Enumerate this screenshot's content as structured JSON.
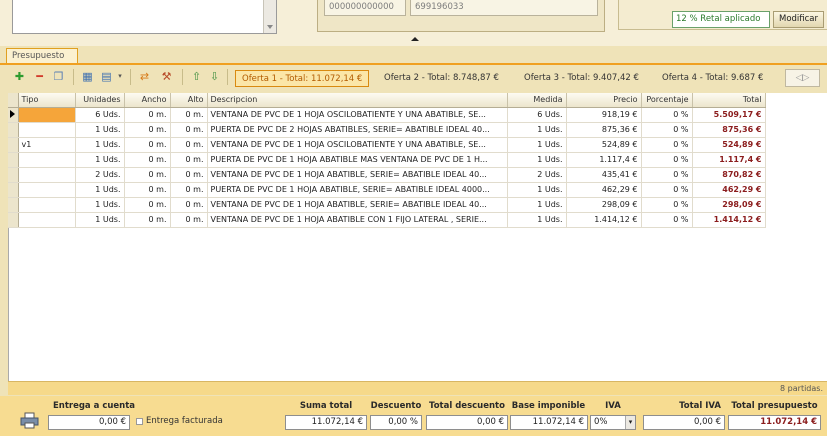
{
  "header": {
    "phone1": "000000000000",
    "phone2": "699196033",
    "retal_text": "12 % Retal aplicado",
    "modificar_label": "Modificar"
  },
  "tab": {
    "label": "Presupuesto"
  },
  "toolbar": {
    "icons": [
      "add-icon",
      "remove-icon",
      "copy-icon",
      "calculator-icon",
      "list-dropdown-icon",
      "transfer-icon",
      "tools-icon",
      "arrow-up-icon",
      "arrow-down-icon"
    ],
    "ofertas": [
      "Oferta 1 - Total: 11.072,14 €",
      "Oferta 2 - Total: 8.748,87 €",
      "Oferta 3 - Total: 9.407,42 €",
      "Oferta 4 - Total: 9.687 €"
    ],
    "active_oferta": 0
  },
  "table": {
    "headers": {
      "tipo": "Tipo",
      "unidades": "Unidades",
      "ancho": "Ancho",
      "alto": "Alto",
      "descripcion": "Descripcion",
      "medida": "Medida",
      "precio": "Precio",
      "porcentaje": "Porcentaje",
      "total": "Total"
    },
    "rows": [
      {
        "tipo": "",
        "unidades": "6 Uds.",
        "ancho": "0 m.",
        "alto": "0 m.",
        "descripcion": "VENTANA DE PVC DE 1 HOJA OSCILOBATIENTE Y UNA ABATIBLE, SE...",
        "medida": "6 Uds.",
        "precio": "918,19 €",
        "porcentaje": "0 %",
        "total": "5.509,17 €"
      },
      {
        "tipo": "",
        "unidades": "1 Uds.",
        "ancho": "0 m.",
        "alto": "0 m.",
        "descripcion": "PUERTA DE PVC DE 2 HOJAS ABATIBLES, SERIE= ABATIBLE IDEAL 40...",
        "medida": "1 Uds.",
        "precio": "875,36 €",
        "porcentaje": "0 %",
        "total": "875,36 €"
      },
      {
        "tipo": "v1",
        "unidades": "1 Uds.",
        "ancho": "0 m.",
        "alto": "0 m.",
        "descripcion": "VENTANA DE PVC DE 1 HOJA OSCILOBATIENTE Y UNA ABATIBLE, SE...",
        "medida": "1 Uds.",
        "precio": "524,89 €",
        "porcentaje": "0 %",
        "total": "524,89 €"
      },
      {
        "tipo": "",
        "unidades": "1 Uds.",
        "ancho": "0 m.",
        "alto": "0 m.",
        "descripcion": "PUERTA DE PVC DE 1 HOJA ABATIBLE MAS VENTANA DE PVC DE 1 H...",
        "medida": "1 Uds.",
        "precio": "1.117,4 €",
        "porcentaje": "0 %",
        "total": "1.117,4 €"
      },
      {
        "tipo": "",
        "unidades": "2 Uds.",
        "ancho": "0 m.",
        "alto": "0 m.",
        "descripcion": "VENTANA DE PVC DE 1 HOJA ABATIBLE, SERIE= ABATIBLE IDEAL 40...",
        "medida": "2 Uds.",
        "precio": "435,41 €",
        "porcentaje": "0 %",
        "total": "870,82 €"
      },
      {
        "tipo": "",
        "unidades": "1 Uds.",
        "ancho": "0 m.",
        "alto": "0 m.",
        "descripcion": "PUERTA DE PVC DE 1 HOJA ABATIBLE, SERIE= ABATIBLE IDEAL 4000...",
        "medida": "1 Uds.",
        "precio": "462,29 €",
        "porcentaje": "0 %",
        "total": "462,29 €"
      },
      {
        "tipo": "",
        "unidades": "1 Uds.",
        "ancho": "0 m.",
        "alto": "0 m.",
        "descripcion": "VENTANA DE PVC DE 1 HOJA ABATIBLE, SERIE= ABATIBLE IDEAL 40...",
        "medida": "1 Uds.",
        "precio": "298,09 €",
        "porcentaje": "0 %",
        "total": "298,09 €"
      },
      {
        "tipo": "",
        "unidades": "1 Uds.",
        "ancho": "0 m.",
        "alto": "0 m.",
        "descripcion": "VENTANA DE PVC DE 1 HOJA ABATIBLE CON 1 FIJO LATERAL , SERIE...",
        "medida": "1 Uds.",
        "precio": "1.414,12 €",
        "porcentaje": "0 %",
        "total": "1.414,12 €"
      }
    ],
    "count_text": "8 partidas."
  },
  "footer": {
    "entrega_label": "Entrega a cuenta",
    "entrega_value": "0,00 €",
    "entrega_facturada_label": "Entrega facturada",
    "suma_total_label": "Suma total",
    "suma_total_value": "11.072,14 €",
    "descuento_label": "Descuento",
    "descuento_value": "0,00 %",
    "total_descuento_label": "Total descuento",
    "total_descuento_value": "0,00 €",
    "base_imponible_label": "Base imponible",
    "base_imponible_value": "11.072,14 €",
    "iva_label": "IVA",
    "iva_value": "0%",
    "total_iva_label": "Total IVA",
    "total_iva_value": "0,00 €",
    "total_presupuesto_label": "Total presupuesto",
    "total_presupuesto_value": "11.072,14 €"
  },
  "colors": {
    "accent": "#f0a020",
    "total_red": "#8b1c1c",
    "footer_bg": "#f7dc91",
    "panel_bg": "#efe3b8"
  }
}
